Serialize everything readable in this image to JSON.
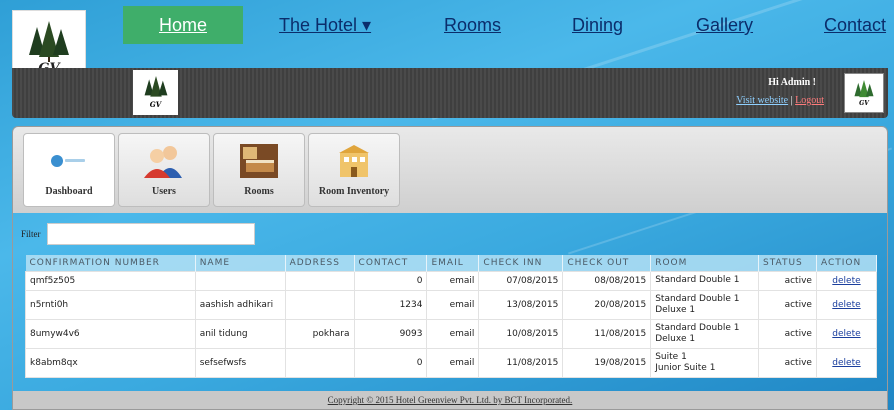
{
  "brand": {
    "logo_text": "GV"
  },
  "nav": {
    "items": [
      {
        "label": "Home"
      },
      {
        "label": "The Hotel ▾"
      },
      {
        "label": "Rooms"
      },
      {
        "label": "Dining"
      },
      {
        "label": "Gallery"
      },
      {
        "label": "Contact"
      }
    ]
  },
  "admin": {
    "greeting": "Hi Admin !",
    "visit_label": "Visit website",
    "separator": "|",
    "logout_label": "Logout"
  },
  "tabs": [
    {
      "label": "Dashboard",
      "icon": "dashboard-icon"
    },
    {
      "label": "Users",
      "icon": "users-icon"
    },
    {
      "label": "Rooms",
      "icon": "rooms-icon"
    },
    {
      "label": "Room Inventory",
      "icon": "room-inventory-icon"
    }
  ],
  "filter": {
    "label": "Filter",
    "value": ""
  },
  "table": {
    "headers": [
      "CONFIRMATION NUMBER",
      "NAME",
      "ADDRESS",
      "CONTACT",
      "EMAIL",
      "CHECK INN",
      "CHECK OUT",
      "ROOM",
      "STATUS",
      "ACTION"
    ],
    "rows": [
      {
        "conf": "qmf5z505",
        "name": "",
        "address": "",
        "contact": "0",
        "email": "email",
        "checkin": "07/08/2015",
        "checkout": "08/08/2015",
        "room1": "Standard Double  1",
        "room2": "",
        "status": "active",
        "action": "delete"
      },
      {
        "conf": "n5rnti0h",
        "name": "aashish adhikari",
        "address": "",
        "contact": "1234",
        "email": "email",
        "checkin": "13/08/2015",
        "checkout": "20/08/2015",
        "room1": "Standard Double  1",
        "room2": "Deluxe  1",
        "status": "active",
        "action": "delete"
      },
      {
        "conf": "8umyw4v6",
        "name": "anil tidung",
        "address": "pokhara",
        "contact": "9093",
        "email": "email",
        "checkin": "10/08/2015",
        "checkout": "11/08/2015",
        "room1": "Standard Double  1",
        "room2": "Deluxe  1",
        "status": "active",
        "action": "delete"
      },
      {
        "conf": "k8abm8qx",
        "name": "sefsefwsfs",
        "address": "",
        "contact": "0",
        "email": "email",
        "checkin": "11/08/2015",
        "checkout": "19/08/2015",
        "room1": "Suite  1",
        "room2": "Junior Suite  1",
        "status": "active",
        "action": "delete"
      }
    ]
  },
  "footer": {
    "text": "Copyright © 2015 Hotel Greenview Pvt. Ltd. by BCT Incorporated."
  },
  "colors": {
    "nav_active": "#3fae6a",
    "nav_link": "#0b2d6b",
    "logout": "#ff7b7b",
    "delete_link": "#1b3f9e"
  }
}
